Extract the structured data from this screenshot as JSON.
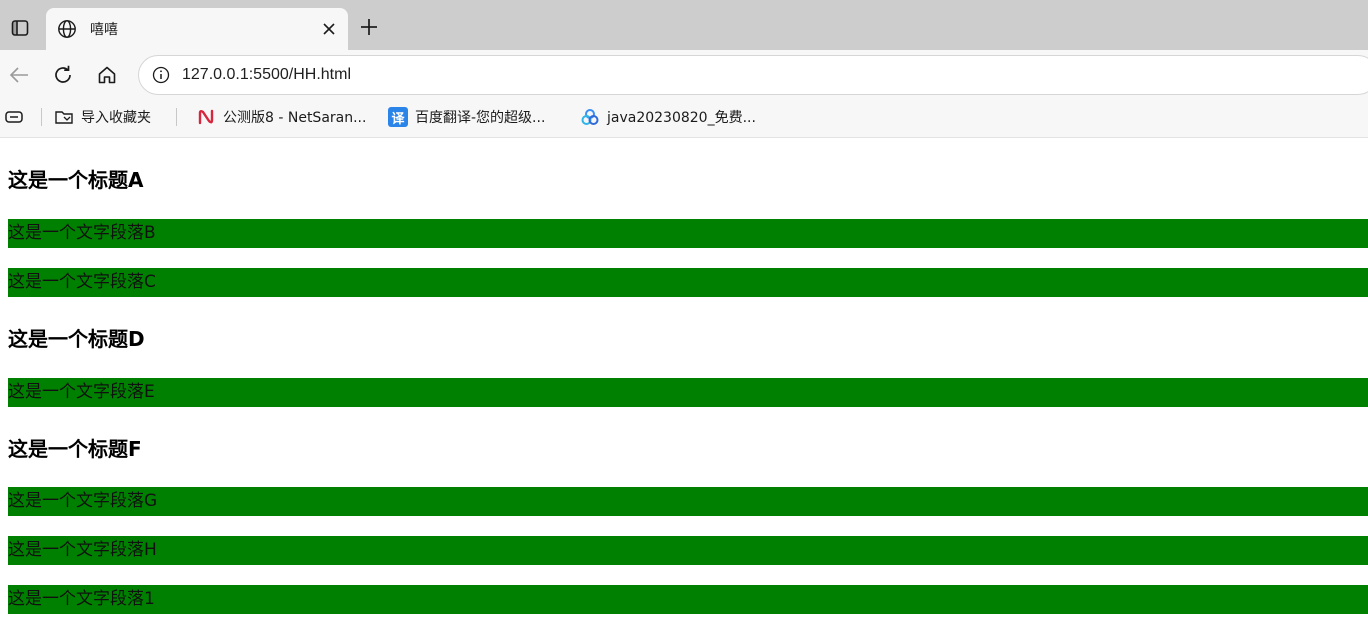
{
  "browser": {
    "tab": {
      "title": "嘻嘻"
    },
    "address_bar": {
      "url": "127.0.0.1:5500/HH.html"
    },
    "bookmarks": [
      {
        "label": "导入收藏夹",
        "icon": "import-favorites-icon"
      },
      {
        "label": "公测版8 - NetSaran...",
        "icon": "netsarang-icon"
      },
      {
        "label": "百度翻译-您的超级...",
        "icon": "baidu-translate-icon",
        "icon_text": "译",
        "icon_color": "#2b84e8"
      },
      {
        "label": "java20230820_免费...",
        "icon": "baidu-netdisk-icon"
      }
    ]
  },
  "page": {
    "paragraph_bg": "#008000",
    "heading_a": "这是一个标题A",
    "paragraph_b": "这是一个文字段落B",
    "paragraph_c": "这是一个文字段落C",
    "heading_d": "这是一个标题D",
    "paragraph_e": "这是一个文字段落E",
    "heading_f": "这是一个标题F",
    "paragraph_g": "这是一个文字段落G",
    "paragraph_h": "这是一个文字段落H",
    "paragraph_1": "这是一个文字段落1"
  }
}
